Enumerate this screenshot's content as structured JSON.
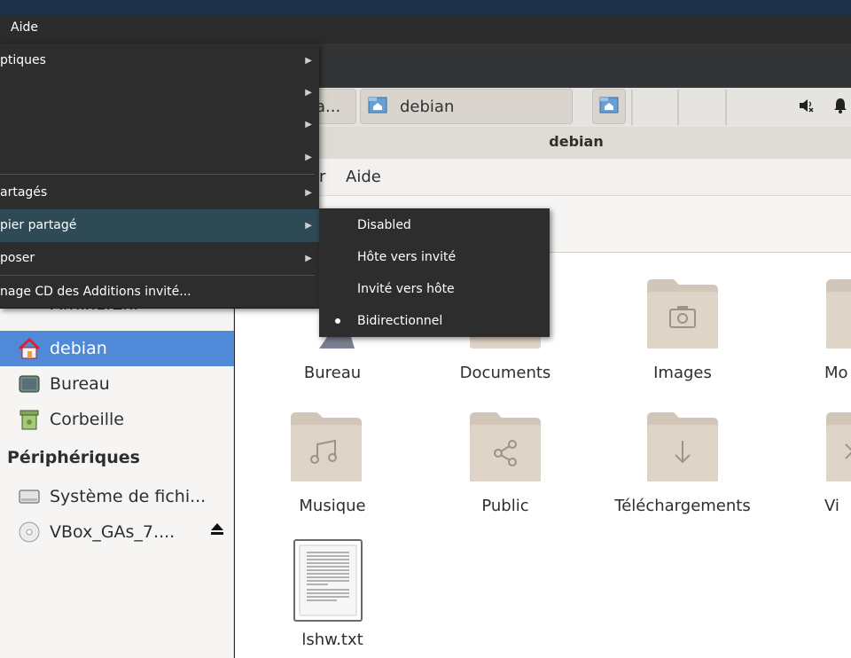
{
  "host_menubar": {
    "aide_label": "Aide"
  },
  "vb_menu": {
    "items": [
      {
        "label": "ptiques"
      },
      {
        "label": ""
      },
      {
        "label": ""
      },
      {
        "label": ""
      },
      {
        "label": "artagés"
      },
      {
        "label": "pier partagé"
      },
      {
        "label": "poser"
      },
      {
        "label": "nage CD des Additions invité..."
      }
    ],
    "submenu": [
      {
        "label": "Disabled"
      },
      {
        "label": "Hôte vers invité"
      },
      {
        "label": "Invité vers hôte"
      },
      {
        "label": "Bidirectionnel"
      }
    ]
  },
  "taskbar": {
    "task1_label": "ia...",
    "task2_label": "debian"
  },
  "window": {
    "title": "debian",
    "menu_fragment": "r",
    "menu_help": "Aide"
  },
  "sidebar": {
    "ordinateur": "Ordinateur",
    "home": "debian",
    "bureau": "Bureau",
    "corbeille": "Corbeille",
    "devices_header": "Périphériques",
    "filesystem": "Système de fichi...",
    "vbox_disc": "VBox_GAs_7...."
  },
  "files": [
    {
      "label": "Bureau"
    },
    {
      "label": "Documents"
    },
    {
      "label": "Images"
    },
    {
      "label": "Mo"
    },
    {
      "label": "Musique"
    },
    {
      "label": "Public"
    },
    {
      "label": "Téléchargements"
    },
    {
      "label": "Vi"
    },
    {
      "label": "lshw.txt"
    }
  ]
}
